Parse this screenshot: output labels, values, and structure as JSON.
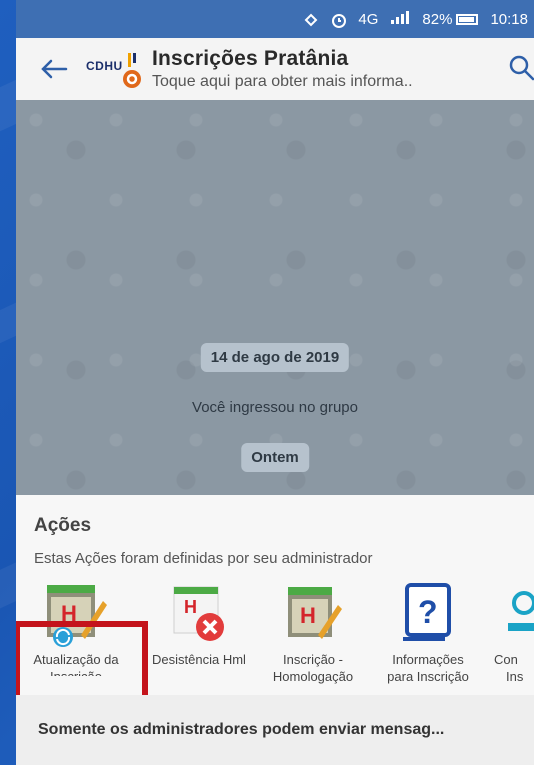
{
  "status": {
    "network": "4G",
    "battery": "82%",
    "time": "10:18"
  },
  "header": {
    "logo_text": "CDHU",
    "title": "Inscrições Pratânia",
    "subtitle": "Toque aqui para obter mais informa.."
  },
  "chat": {
    "date_pill": "14 de ago de 2019",
    "system_message": "Você ingressou no grupo",
    "day_pill": "Ontem"
  },
  "actions": {
    "title": "Ações",
    "subtitle": "Estas Ações foram definidas por seu administrador",
    "items": [
      {
        "label_1": "Atualização da",
        "label_2": "Inscrição",
        "icon": "spreadsheet-refresh-icon"
      },
      {
        "label_1": "Desistência Hml",
        "label_2": "",
        "icon": "spreadsheet-cancel-icon"
      },
      {
        "label_1": "Inscrição -",
        "label_2": "Homologação",
        "icon": "spreadsheet-edit-icon"
      },
      {
        "label_1": "Informações",
        "label_2": "para Inscrição",
        "icon": "question-mark-icon"
      },
      {
        "label_1": "Con",
        "label_2": "Ins",
        "icon": "partial-action-icon"
      }
    ]
  },
  "footer": {
    "text": "Somente os administradores podem enviar mensag..."
  },
  "colors": {
    "statusbar": "#3e6fb3",
    "appbar": "#f4f4f4",
    "highlight": "#c4141c"
  }
}
